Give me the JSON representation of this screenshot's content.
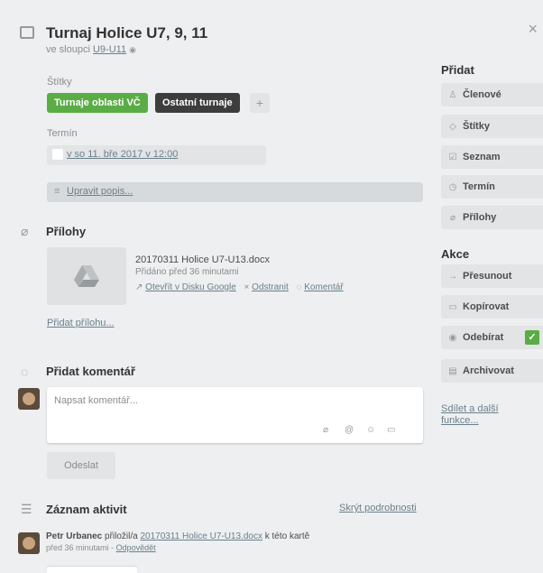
{
  "card": {
    "title": "Turnaj Holice U7, 9, 11",
    "list_prefix": "ve sloupci",
    "list_name": "U9-U11"
  },
  "labels": {
    "heading": "Štítky",
    "items": [
      {
        "text": "Turnaje oblasti VČ",
        "color": "#5aac44"
      },
      {
        "text": "Ostatní turnaje",
        "color": "#3d3d3d"
      }
    ],
    "add": "+"
  },
  "due": {
    "heading": "Termín",
    "value": "v so 11. bře 2017 v 12:00"
  },
  "description": {
    "edit": "Upravit popis..."
  },
  "attachments": {
    "heading": "Přílohy",
    "file_name": "20170311 Holice U7-U13.docx",
    "added": "Přidáno před 36 minutami",
    "open": "Otevřít v Disku Google",
    "remove": "Odstranit",
    "comment": "Komentář",
    "add": "Přidat přílohu..."
  },
  "comment": {
    "heading": "Přidat komentář",
    "placeholder": "Napsat komentář...",
    "send": "Odeslat"
  },
  "activity": {
    "heading": "Záznam aktivit",
    "hide": "Skrýt podrobnosti",
    "user": "Petr Urbanec",
    "action": "přiložil/a",
    "file": "20170311 Holice U7-U13.docx",
    "suffix": "k této kartě",
    "time": "před 36 minutami",
    "separator": "-",
    "reply": "Odpovědět"
  },
  "sidebar": {
    "add_heading": "Přidat",
    "add_items": [
      {
        "label": "Členové",
        "icon": "person-icon",
        "glyph": "♙"
      },
      {
        "label": "Štítky",
        "icon": "tag-icon",
        "glyph": "◇"
      },
      {
        "label": "Seznam",
        "icon": "checklist-icon",
        "glyph": "☑"
      },
      {
        "label": "Termín",
        "icon": "clock-icon",
        "glyph": "◷"
      },
      {
        "label": "Přílohy",
        "icon": "paperclip-icon",
        "glyph": "⌀"
      }
    ],
    "actions_heading": "Akce",
    "action_items": [
      {
        "label": "Přesunout",
        "icon": "arrow-right-icon",
        "glyph": "→"
      },
      {
        "label": "Kopírovat",
        "icon": "card-icon",
        "glyph": "▭"
      },
      {
        "label": "Odebírat",
        "icon": "eye-icon",
        "glyph": "◉"
      },
      {
        "label": "Archivovat",
        "icon": "archive-icon",
        "glyph": "▤"
      }
    ],
    "share": "Sdílet a další funkce..."
  }
}
